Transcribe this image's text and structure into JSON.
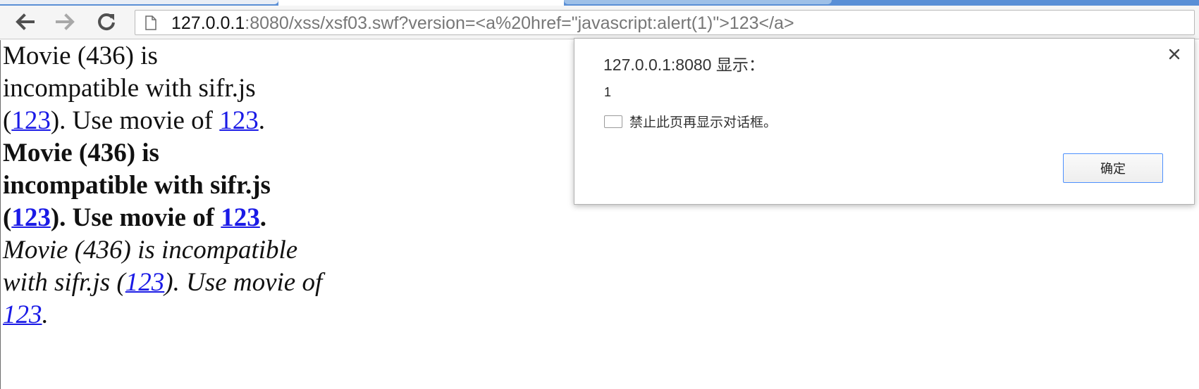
{
  "browser": {
    "back_icon": "back-arrow-icon",
    "forward_icon": "forward-arrow-icon",
    "reload_icon": "reload-icon",
    "page_icon": "page-icon",
    "url_host": "127.0.0.1",
    "url_rest": ":8080/xss/xsf03.swf?version=<a%20href=\"javascript:alert(1)\">123</a>"
  },
  "content": {
    "paragraphs": [
      {
        "line1": "Movie (436) is",
        "line2": "incompatible with sifr.js",
        "line3_pre": "(",
        "link1": "123",
        "line3_mid": "). Use movie of ",
        "link2": "123",
        "line3_post": "."
      },
      {
        "line1": "Movie (436) is",
        "line2": "incompatible with sifr.js",
        "line3_pre": "(",
        "link1": "123",
        "line3_mid": "). Use movie of ",
        "link2": "123",
        "line3_post": "."
      },
      {
        "line1": "Movie (436) is incompatible",
        "line2_pre": "with sifr.js (",
        "link1": "123",
        "line2_mid": "). Use movie of",
        "link2": "123",
        "line3_post": "."
      }
    ]
  },
  "dialog": {
    "title": "127.0.0.1:8080 显示：",
    "message": "1",
    "suppress_label": "禁止此页再显示对话框。",
    "ok_label": "确定",
    "close_icon": "close-icon"
  },
  "colors": {
    "link": "#1a1ae6",
    "tabstrip": "#5a8fd6",
    "ok_border": "#4d90fe"
  }
}
